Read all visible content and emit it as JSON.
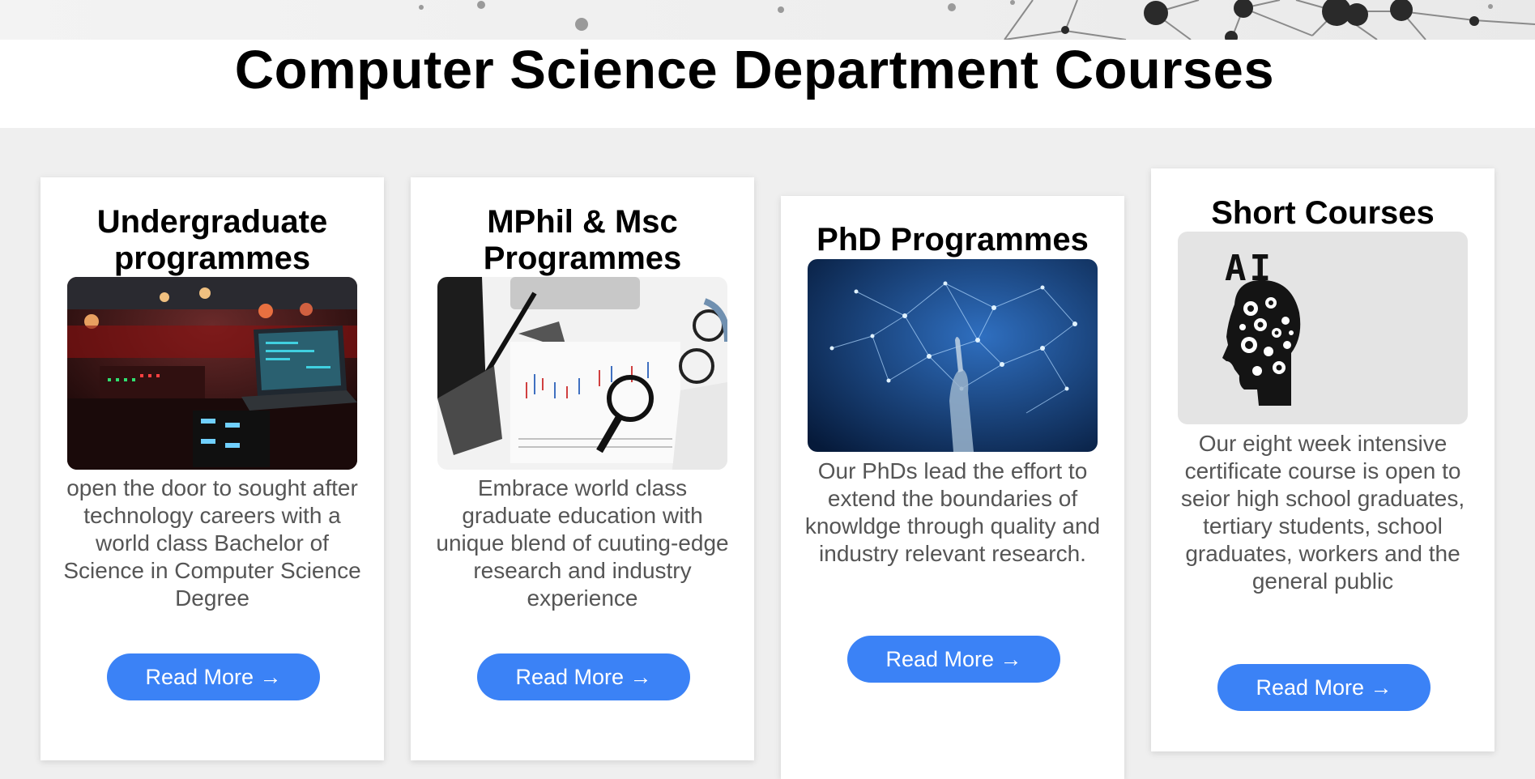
{
  "page": {
    "title": "Computer Science Department Courses"
  },
  "colors": {
    "background": "#efefef",
    "card": "#ffffff",
    "button": "#3b82f6",
    "button_text": "#ffffff",
    "description_text": "#555555"
  },
  "cards": [
    {
      "title": "Undergraduate programmes",
      "image": "concert-laptop-photo",
      "description": "open the door to sought after technology careers with a world class Bachelor of Science in Computer Science Degree",
      "button": "Read More →"
    },
    {
      "title": "MPhil & Msc Programmes",
      "image": "charts-magnifier-photo",
      "description": "Embrace world class graduate education with unique blend of cuuting-edge research and industry experience",
      "button": "Read More →"
    },
    {
      "title": "PhD Programmes",
      "image": "network-hand-photo",
      "description": "Our PhDs lead the effort to extend the boundaries of knowldge through quality and industry relevant research.",
      "button": "Read More →"
    },
    {
      "title": "Short Courses",
      "image": "ai-head-icon",
      "image_text": "AI",
      "description": "Our eight week intensive certificate course is open to seior high school graduates, tertiary students, school graduates, workers and the general public",
      "button": "Read More →"
    }
  ]
}
